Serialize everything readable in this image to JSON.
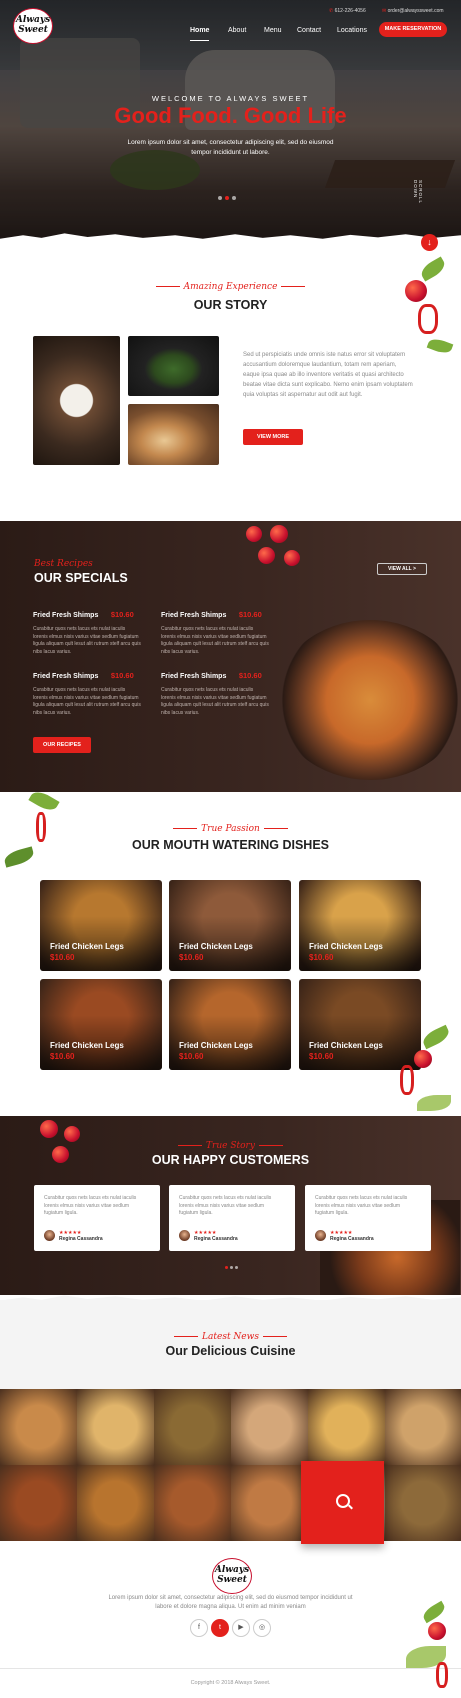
{
  "brand": {
    "logo_line1": "Always",
    "logo_line2": "Sweet"
  },
  "nav": {
    "items": [
      "Home",
      "About",
      "Menu",
      "Contact",
      "Locations"
    ],
    "active": "Home"
  },
  "contact": {
    "phone": "612-226-4056",
    "email": "order@alwayssweet.com"
  },
  "header": {
    "cta": "MAKE RESERVATION"
  },
  "hero": {
    "welcome": "WELCOME TO ALWAYS SWEET",
    "title": "Good Food. Good Life",
    "subtitle": "Lorem ipsum dolor sit amet, consectetur adipiscing elit, sed do eiusmod tempor incididunt ut labore.",
    "scroll_label": "SCROLL DOWN",
    "down_arrow": "↓",
    "slider_count": 3
  },
  "story": {
    "script": "Amazing Experience",
    "title": "OUR STORY",
    "body": "Sed ut perspiciatis unde omnis iste natus error sit voluptatem accusantium doloremque laudantium, totam rem aperiam, eaque ipsa quae ab illo inventore veritatis et quasi architecto beatae vitae dicta sunt explicabo. Nemo enim ipsam voluptatem quia voluptas sit aspernatur aut odit aut fugit.",
    "button": "VIEW MORE"
  },
  "specials": {
    "script": "Best Recipes",
    "title": "OUR SPECIALS",
    "view_all": "VIEW ALL  >",
    "items": [
      {
        "name": "Fried Fresh Shimps",
        "price": "$10.60",
        "desc": "Curabitur quos nets lacus ets nulat iaculis lorenis elmus nisis varius vitae sedlum fugiatum ligula aliquam qult lesut alit rutrum stelf arcu quis nibs lacus varius."
      },
      {
        "name": "Fried Fresh Shimps",
        "price": "$10.60",
        "desc": "Curabitur quos nets lacus ets nulat iaculis lorenis elmus nisis varius vitae sedlum fugiatum ligula aliquam qult lesut alit rutrum stelf arcu quis nibs lacus varius."
      },
      {
        "name": "Fried Fresh Shimps",
        "price": "$10.60",
        "desc": "Curabitur quos nets lacus ets nulat iaculis lorenis elmus nisis varius vitae sedlum fugiatum ligula aliquam qult lesut alit rutrum stelf arcu quis nibs lacus varius."
      },
      {
        "name": "Fried Fresh Shimps",
        "price": "$10.60",
        "desc": "Curabitur quos nets lacus ets nulat iaculis lorenis elmus nisis varius vitae sedlum fugiatum ligula aliquam qult lesut alit rutrum stelf arcu quis nibs lacus varius."
      }
    ],
    "button": "OUR RECIPES"
  },
  "dishes": {
    "script": "True Passion",
    "title": "OUR MOUTH WATERING DISHES",
    "items": [
      {
        "name": "Fried Chicken Legs",
        "price": "$10.60",
        "tone": "#b7782f"
      },
      {
        "name": "Fried Chicken Legs",
        "price": "$10.60",
        "tone": "#8e5a3a"
      },
      {
        "name": "Fried Chicken Legs",
        "price": "$10.60",
        "tone": "#d9a24a"
      },
      {
        "name": "Fried Chicken Legs",
        "price": "$10.60",
        "tone": "#9a4a22"
      },
      {
        "name": "Fried Chicken Legs",
        "price": "$10.60",
        "tone": "#b5662c"
      },
      {
        "name": "Fried Chicken Legs",
        "price": "$10.60",
        "tone": "#7a4a24"
      }
    ]
  },
  "customers": {
    "script": "True Story",
    "title": "OUR HAPPY CUSTOMERS",
    "reviews": [
      {
        "text": "Curabitur quos nets lacus ets nulat iaculis lorenis elmus nisis varius vitae sedlum fugiatum ligula.",
        "stars": "★★★★★",
        "name": "Regina Cassandra"
      },
      {
        "text": "Curabitur quos nets lacus ets nulat iaculis lorenis elmus nisis varius vitae sedlum fugiatum ligula.",
        "stars": "★★★★★",
        "name": "Regina Cassandra"
      },
      {
        "text": "Curabitur quos nets lacus ets nulat iaculis lorenis elmus nisis varius vitae sedlum fugiatum ligula.",
        "stars": "★★★★★",
        "name": "Regina Cassandra"
      }
    ],
    "slider_count": 3
  },
  "cuisine": {
    "script": "Latest News",
    "title": "Our Delicious Cuisine",
    "tiles": [
      "#c98a4a",
      "#e0b46a",
      "#8a6a34",
      "#d4a77a",
      "#e1b15a",
      "#cfa26a",
      "#9a4a22",
      "#b8742e",
      "#a65a2c",
      "#c07a44",
      "#d9c9a6",
      "#8d6a3a"
    ]
  },
  "footer": {
    "text": "Lorem ipsum dolor sit amet, consectetur adipiscing elit, sed do eiusmod tempor incididunt ut labore et dolore magna aliqua. Ut enim ad minim veniam",
    "social": [
      "f",
      "t",
      "▶",
      "◎"
    ],
    "copyright": "Copyright © 2018 Always Sweet."
  },
  "colors": {
    "accent": "#e3211c",
    "dark_bg": "#2b1b16"
  }
}
